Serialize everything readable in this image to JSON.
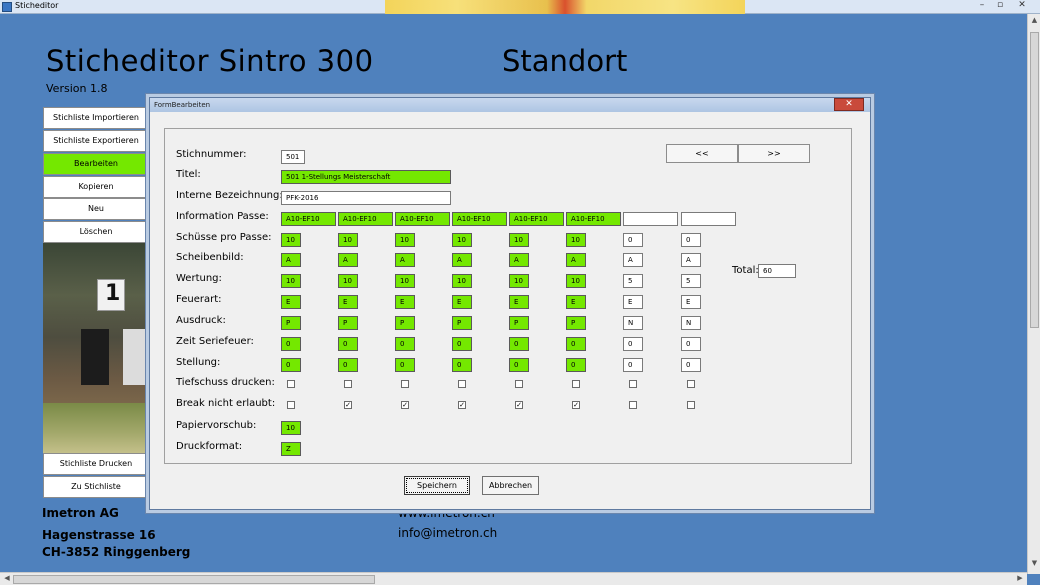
{
  "window": {
    "title": "Sticheditor"
  },
  "header": {
    "title": "Sticheditor Sintro 300",
    "location": "Standort",
    "version": "Version 1.8"
  },
  "nav": {
    "import": "Stichliste Importieren",
    "export": "Stichliste Exportieren",
    "edit": "Bearbeiten",
    "copy": "Kopieren",
    "new": "Neu",
    "delete": "Löschen",
    "print": "Stichliste Drucken",
    "back": "Zu Stichliste",
    "target_number": "1"
  },
  "footer": {
    "company": "Imetron AG",
    "street": "Hagenstrasse 16",
    "city": "CH-3852 Ringgenberg",
    "web": "www.imetron.ch",
    "email": "info@imetron.ch"
  },
  "dialog": {
    "title": "FormBearbeiten",
    "close": "✕",
    "prev": "<<",
    "next": ">>",
    "save": "Speichern",
    "cancel": "Abbrechen",
    "labels": {
      "stichnummer": "Stichnummer:",
      "titel": "Titel:",
      "interne": "Interne Bezeichnung:",
      "info_passe": "Information Passe:",
      "schuesse": "Schüsse pro Passe:",
      "scheibenbild": "Scheibenbild:",
      "wertung": "Wertung:",
      "feuerart": "Feuerart:",
      "ausdruck": "Ausdruck:",
      "zeit": "Zeit Seriefeuer:",
      "stellung": "Stellung:",
      "tiefschuss": "Tiefschuss drucken:",
      "break": "Break nicht erlaubt:",
      "papier": "Papiervorschub:",
      "druckformat": "Druckformat:",
      "total": "Total:"
    },
    "values": {
      "stichnummer": "501",
      "titel": "501 1-Stellungs Meisterschaft",
      "interne": "PFK-2016",
      "total": "60",
      "papier": "10",
      "druckformat": "Z"
    },
    "columns": [
      {
        "info": "A10-EF10",
        "schuesse": "10",
        "scheibenbild": "A",
        "wertung": "10",
        "feuerart": "E",
        "ausdruck": "P",
        "zeit": "0",
        "stellung": "0",
        "tiefschuss": false,
        "break": false
      },
      {
        "info": "A10-EF10",
        "schuesse": "10",
        "scheibenbild": "A",
        "wertung": "10",
        "feuerart": "E",
        "ausdruck": "P",
        "zeit": "0",
        "stellung": "0",
        "tiefschuss": false,
        "break": true
      },
      {
        "info": "A10-EF10",
        "schuesse": "10",
        "scheibenbild": "A",
        "wertung": "10",
        "feuerart": "E",
        "ausdruck": "P",
        "zeit": "0",
        "stellung": "0",
        "tiefschuss": false,
        "break": true
      },
      {
        "info": "A10-EF10",
        "schuesse": "10",
        "scheibenbild": "A",
        "wertung": "10",
        "feuerart": "E",
        "ausdruck": "P",
        "zeit": "0",
        "stellung": "0",
        "tiefschuss": false,
        "break": true
      },
      {
        "info": "A10-EF10",
        "schuesse": "10",
        "scheibenbild": "A",
        "wertung": "10",
        "feuerart": "E",
        "ausdruck": "P",
        "zeit": "0",
        "stellung": "0",
        "tiefschuss": false,
        "break": true
      },
      {
        "info": "A10-EF10",
        "schuesse": "10",
        "scheibenbild": "A",
        "wertung": "10",
        "feuerart": "E",
        "ausdruck": "P",
        "zeit": "0",
        "stellung": "0",
        "tiefschuss": false,
        "break": true
      },
      {
        "info": "",
        "schuesse": "0",
        "scheibenbild": "A",
        "wertung": "5",
        "feuerart": "E",
        "ausdruck": "N",
        "zeit": "0",
        "stellung": "0",
        "tiefschuss": false,
        "break": false
      },
      {
        "info": "",
        "schuesse": "0",
        "scheibenbild": "A",
        "wertung": "5",
        "feuerart": "E",
        "ausdruck": "N",
        "zeit": "0",
        "stellung": "0",
        "tiefschuss": false,
        "break": false
      }
    ],
    "active_columns": 6
  },
  "colors": {
    "background": "#4f81bd",
    "active_green": "#74e800"
  }
}
